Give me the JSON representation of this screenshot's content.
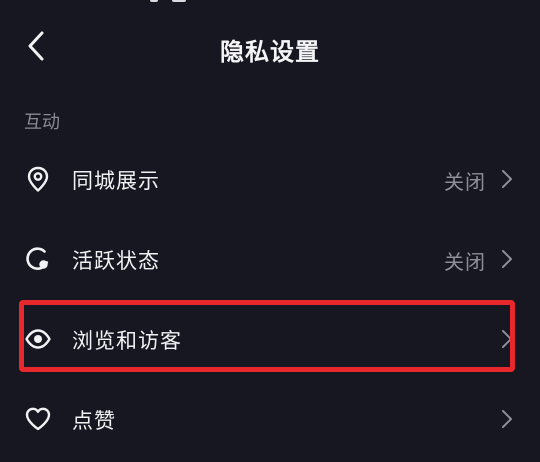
{
  "header": {
    "title": "隐私设置",
    "back_icon": "chevron-left-icon"
  },
  "section": {
    "label": "互动"
  },
  "rows": [
    {
      "label": "同城展示",
      "value": "关闭",
      "icon": "location-pin-icon"
    },
    {
      "label": "活跃状态",
      "value": "关闭",
      "icon": "active-status-icon"
    },
    {
      "label": "浏览和访客",
      "value": "",
      "icon": "eye-icon"
    },
    {
      "label": "点赞",
      "value": "",
      "icon": "heart-icon"
    }
  ],
  "colors": {
    "background": "#171721",
    "text": "#f2f2f4",
    "muted": "#8e8e96",
    "highlight": "#e8282c"
  }
}
